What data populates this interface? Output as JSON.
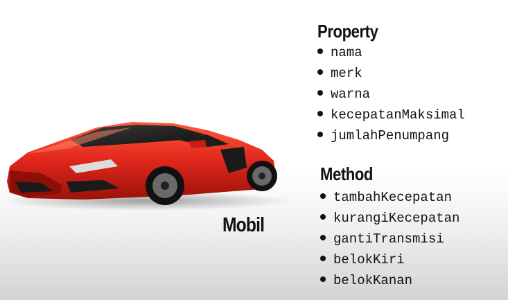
{
  "object_label": "Mobil",
  "property": {
    "title": "Property",
    "items": [
      "nama",
      "merk",
      "warna",
      "kecepatanMaksimal",
      "jumlahPenumpang"
    ]
  },
  "method": {
    "title": "Method",
    "items": [
      "tambahKecepatan",
      "kurangiKecepatan",
      "gantiTransmisi",
      "belokKiri",
      "belokKanan"
    ]
  },
  "colors": {
    "car_body": "#e0261b",
    "text": "#111111"
  }
}
